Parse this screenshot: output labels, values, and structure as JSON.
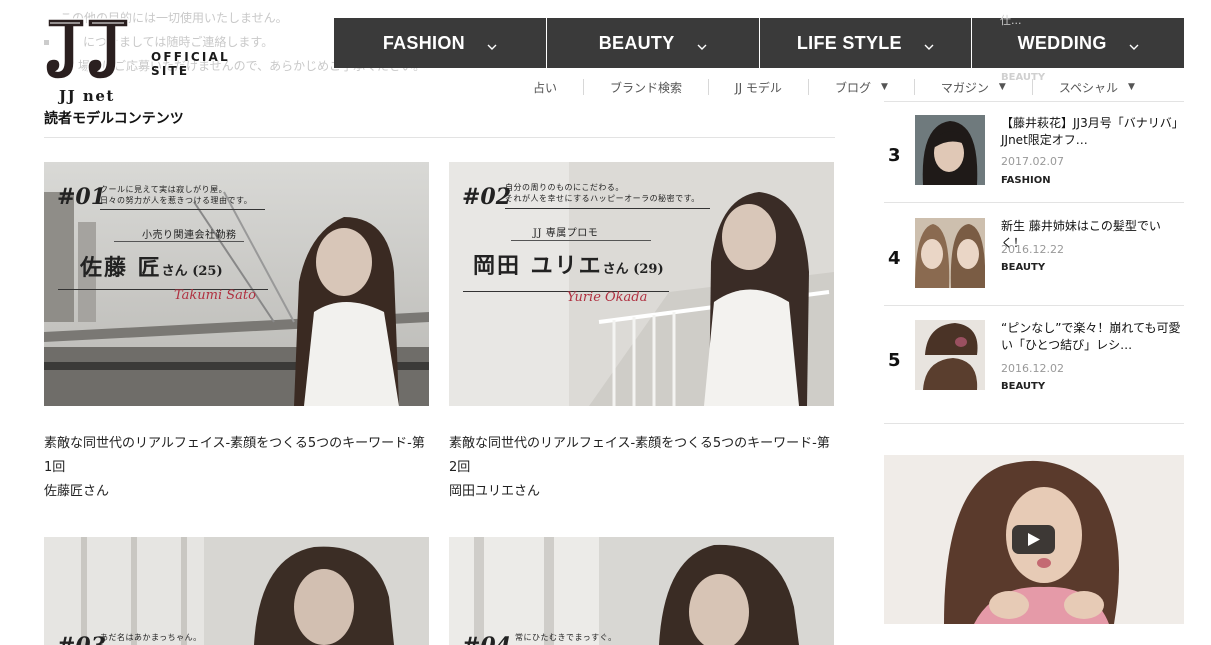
{
  "ghost": {
    "line1": "この他の目的には一切使用いたしません。",
    "line2": "につきましては随時ご連絡します。",
    "line3": "場合はご応募いただけませんので、あらかじめご了承ください。"
  },
  "logo": {
    "mark": "JJ",
    "official": "OFFICIAL SITE",
    "net": "JJ net"
  },
  "section": {
    "title": "読者モデルコンテンツ"
  },
  "nav": {
    "items": [
      {
        "label": "FASHION"
      },
      {
        "label": "BEAUTY"
      },
      {
        "label": "LIFE STYLE"
      },
      {
        "label": "WEDDING"
      }
    ]
  },
  "subnav": {
    "items": [
      {
        "label": "占い"
      },
      {
        "label": "ブランド検索"
      },
      {
        "label": "JJ モデル"
      },
      {
        "label": "ブログ",
        "dropdown": "▼"
      },
      {
        "label": "マガジン",
        "dropdown": "▼"
      },
      {
        "label": "スペシャル",
        "dropdown": "▼"
      }
    ]
  },
  "cards": [
    {
      "num": "#01",
      "tagline1": "クールに見えて実は寂しがり屋。",
      "tagline2": "日々の努力が人を惹きつける理由です。",
      "role": "小売り関連会社勤務",
      "name": "佐藤 匠",
      "san": "さん (25)",
      "signature": "Takumi Sato",
      "caption1": "素敵な同世代のリアルフェイス-素顔をつくる5つのキーワード-第1回",
      "caption2": "佐藤匠さん"
    },
    {
      "num": "#02",
      "tagline1": "自分の周りのものにこだわる。",
      "tagline2": "それが人を幸せにするハッピーオーラの秘密です。",
      "role": "JJ 専属プロモ",
      "name": "岡田 ユリエ",
      "san": "さん (29)",
      "signature": "Yurie Okada",
      "caption1": "素敵な同世代のリアルフェイス-素顔をつくる5つのキーワード-第2回",
      "caption2": "岡田ユリエさん"
    },
    {
      "num": "#03",
      "tagline1": "あだ名はあかまっちゃん。"
    },
    {
      "num": "#04",
      "tagline1": "常にひたむきでまっすぐ。"
    }
  ],
  "ranking": {
    "ghost_title": "仕...",
    "ghost_cat": "BEAUTY",
    "items": [
      {
        "rank": "3",
        "title": "【藤井萩花】JJ3月号「バナリバ」JJnet限定オフ…",
        "date": "2017.02.07",
        "category": "FASHION"
      },
      {
        "rank": "4",
        "title": "新生 藤井姉妹はこの髪型でいく！",
        "date": "2016.12.22",
        "category": "BEAUTY"
      },
      {
        "rank": "5",
        "title": "“ピンなし”で楽々！崩れても可愛い「ひとつ結び」レシ…",
        "date": "2016.12.02",
        "category": "BEAUTY"
      }
    ]
  },
  "icons": {
    "chevron": "chevron-down-icon",
    "play": "play-icon"
  }
}
